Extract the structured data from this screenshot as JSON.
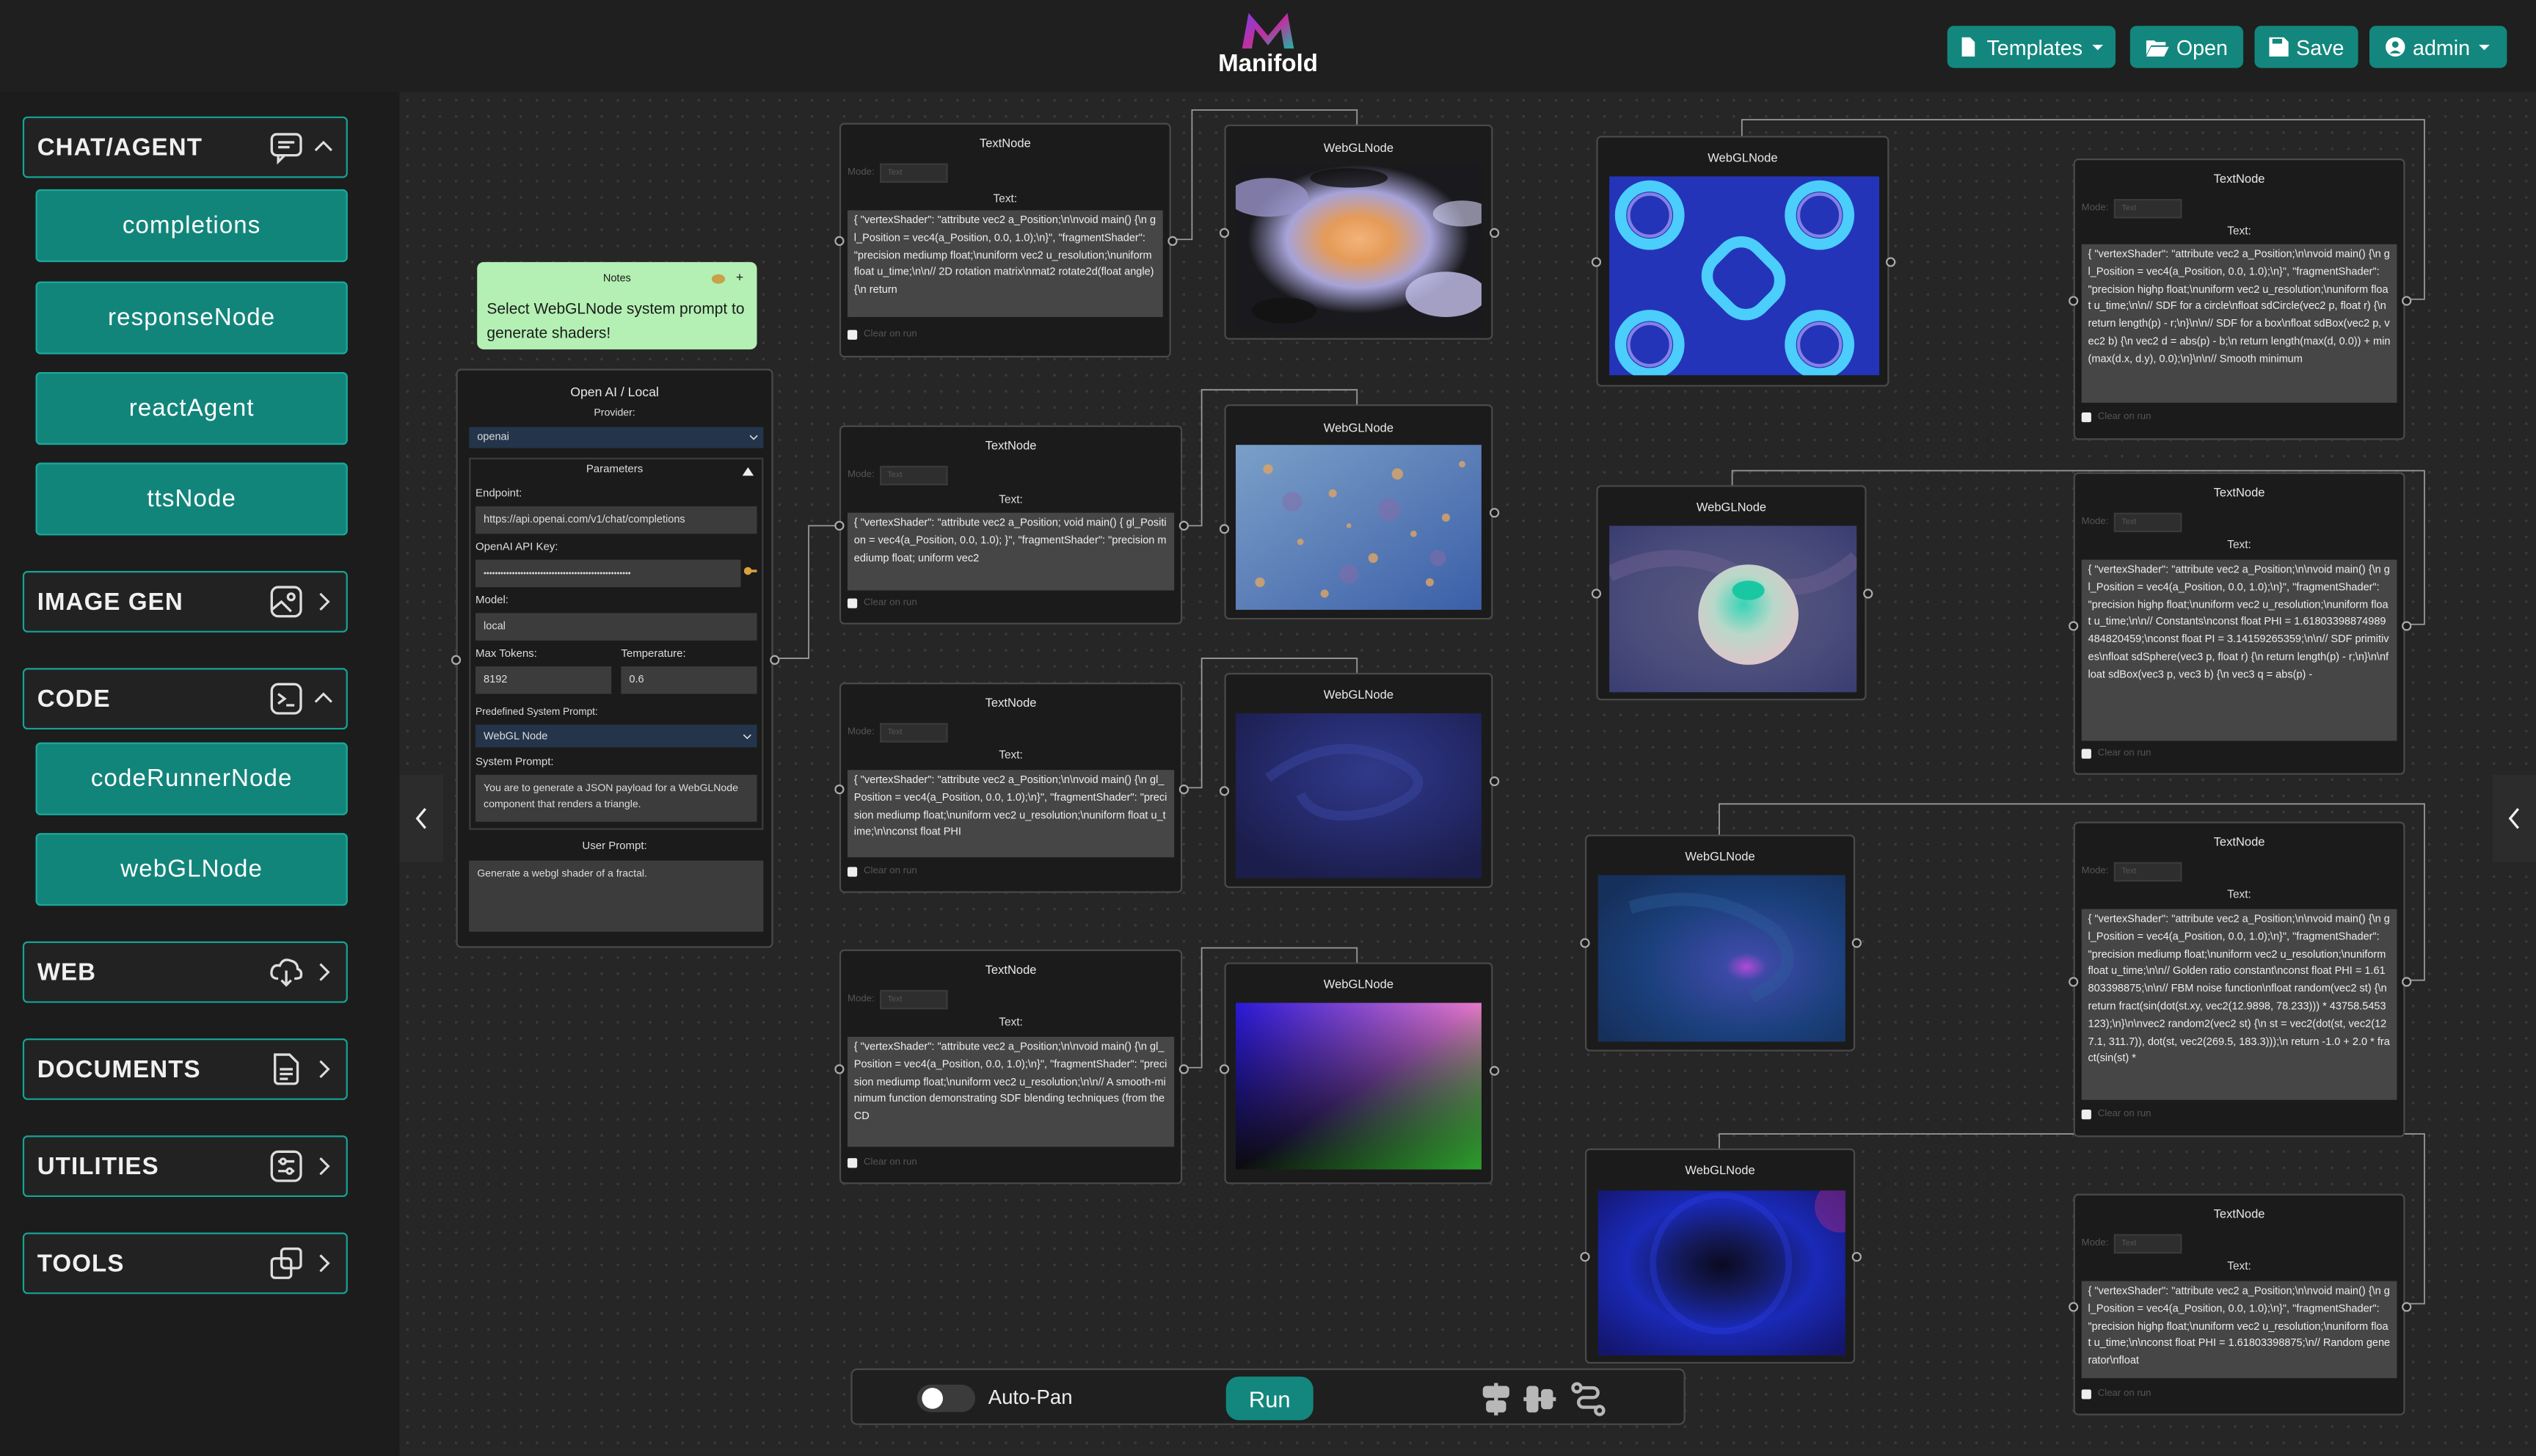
{
  "header": {
    "brand": "Manifold",
    "templates_label": "Templates",
    "open_label": "Open",
    "save_label": "Save",
    "user_label": "admin"
  },
  "sidebar": {
    "sections": [
      {
        "label": "CHAT/AGENT",
        "icon": "chat-icon",
        "expanded": true
      },
      {
        "label": "IMAGE GEN",
        "icon": "image-icon",
        "expanded": false
      },
      {
        "label": "CODE",
        "icon": "terminal-icon",
        "expanded": true
      },
      {
        "label": "WEB",
        "icon": "cloud-download-icon",
        "expanded": false
      },
      {
        "label": "DOCUMENTS",
        "icon": "document-icon",
        "expanded": false
      },
      {
        "label": "UTILITIES",
        "icon": "sliders-icon",
        "expanded": false
      },
      {
        "label": "TOOLS",
        "icon": "copy-icon",
        "expanded": false
      }
    ],
    "chat_items": [
      "completions",
      "responseNode",
      "reactAgent",
      "ttsNode"
    ],
    "code_items": [
      "codeRunnerNode",
      "webGLNode"
    ]
  },
  "notes": {
    "title": "Notes",
    "body": "Select WebGLNode system prompt to generate shaders!"
  },
  "openai": {
    "title": "Open AI / Local",
    "provider_label": "Provider:",
    "provider_value": "openai",
    "params_label": "Parameters",
    "endpoint_label": "Endpoint:",
    "endpoint_value": "https://api.openai.com/v1/chat/completions",
    "apikey_label": "OpenAI API Key:",
    "apikey_value": "••••••••••••••••••••••••••••••••••••••••••••••••••••",
    "model_label": "Model:",
    "model_value": "local",
    "max_tokens_label": "Max Tokens:",
    "max_tokens_value": "8192",
    "temperature_label": "Temperature:",
    "temperature_value": "0.6",
    "predef_label": "Predefined System Prompt:",
    "predef_value": "WebGL Node",
    "system_label": "System Prompt:",
    "system_value": "You are to generate a JSON payload for a WebGLNode component that renders a triangle.",
    "user_label": "User Prompt:",
    "user_value": "Generate a webgl shader of a fractal."
  },
  "text_node": {
    "title": "TextNode",
    "mode_label": "Mode:",
    "mode_value": "Text",
    "text_label": "Text:",
    "clear_label": "Clear on run"
  },
  "webgl_title": "WebGLNode",
  "text_nodes": [
    {
      "content": "{\n  \"vertexShader\": \"attribute vec2 a_Position;\\n\\nvoid main() {\\n    gl_Position = vec4(a_Position, 0.0, 1.0);\\n}\",\n  \"fragmentShader\": \"precision mediump float;\\nuniform vec2 u_resolution;\\nuniform float u_time;\\n\\n// 2D rotation matrix\\nmat2 rotate2d(float angle) {\\n    return"
    },
    {
      "content": "{\n  \"vertexShader\": \"attribute vec2 a_Position; void main() { gl_Position = vec4(a_Position, 0.0, 1.0); }\",\n  \"fragmentShader\": \"precision mediump float; uniform vec2"
    },
    {
      "content": "{\n  \"vertexShader\": \"attribute vec2 a_Position;\\n\\nvoid main() {\\n    gl_Position = vec4(a_Position, 0.0, 1.0);\\n}\",\n  \"fragmentShader\": \"precision mediump float;\\nuniform vec2 u_resolution;\\nuniform float u_time;\\n\\nconst float PHI"
    },
    {
      "content": "{\n  \"vertexShader\": \"attribute vec2 a_Position;\\n\\nvoid main() {\\n    gl_Position = vec4(a_Position, 0.0, 1.0);\\n}\",\n  \"fragmentShader\": \"precision mediump float;\\nuniform vec2 u_resolution;\\n\\n// A smooth-minimum function demonstrating SDF blending techniques (from the CD"
    },
    {
      "content": "{\n  \"vertexShader\": \"attribute vec2 a_Position;\\n\\nvoid main() {\\n    gl_Position = vec4(a_Position, 0.0, 1.0);\\n}\",\n  \"fragmentShader\": \"precision highp float;\\nuniform vec2 u_resolution;\\nuniform float u_time;\\n\\n// SDF for a circle\\nfloat sdCircle(vec2 p, float r) {\\n    return length(p) - r;\\n}\\n\\n// SDF for a box\\nfloat sdBox(vec2 p, vec2 b) {\\n    vec2 d = abs(p) - b;\\n    return length(max(d, 0.0)) + min(max(d.x, d.y), 0.0);\\n}\\n\\n// Smooth minimum"
    },
    {
      "content": "{\n  \"vertexShader\": \"attribute vec2 a_Position;\\n\\nvoid main() {\\n    gl_Position = vec4(a_Position, 0.0, 1.0);\\n}\",\n  \"fragmentShader\": \"precision highp float;\\nuniform vec2 u_resolution;\\nuniform float u_time;\\n\\n// Constants\\nconst float PHI = 1.6180339887498948482045​9;\\nconst float PI = 3.14159265359;\\n\\n// SDF primitives\\nfloat sdSphere(vec3 p, float r) {\\n    return length(p) - r;\\n}\\n\\nfloat sdBox(vec3 p, vec3 b) {\\n    vec3 q = abs(p) -"
    },
    {
      "content": "{\n  \"vertexShader\": \"attribute vec2 a_Position;\\n\\nvoid main() {\\n    gl_Position = vec4(a_Position, 0.0, 1.0);\\n}\",\n  \"fragmentShader\": \"precision mediump float;\\nuniform vec2 u_resolution;\\nuniform float u_time;\\n\\n// Golden ratio constant\\nconst float PHI = 1.61803398875;\\n\\n// FBM noise function\\nfloat random(vec2 st) {\\n    return fract(sin(dot(st.xy, vec2(12.9898, 78.233))) * 43758.5453123);\\n}\\n\\nvec2 random2(vec2 st) {\\n    st = vec2(dot(st, vec2(127.1, 311.7)), dot(st, vec2(269.5, 183.3)));\\n    return -1.0 + 2.0 * fract(sin(st) *"
    },
    {
      "content": "{\n  \"vertexShader\": \"attribute vec2 a_Position;\\n\\nvoid main() {\\n    gl_Position = vec4(a_Position, 0.0, 1.0);\\n}\",\n  \"fragmentShader\": \"precision highp float;\\nuniform vec2 u_resolution;\\nuniform float u_time;\\n\\nconst float PHI = 1.61803398875;\\n// Random generator\\nfloat"
    }
  ],
  "toolbar": {
    "autopan_label": "Auto-Pan",
    "autopan_on": false,
    "run_label": "Run"
  },
  "colors": {
    "accent": "#13877d",
    "accent_border": "#16a394",
    "notes_bg": "#b4f0b4"
  }
}
